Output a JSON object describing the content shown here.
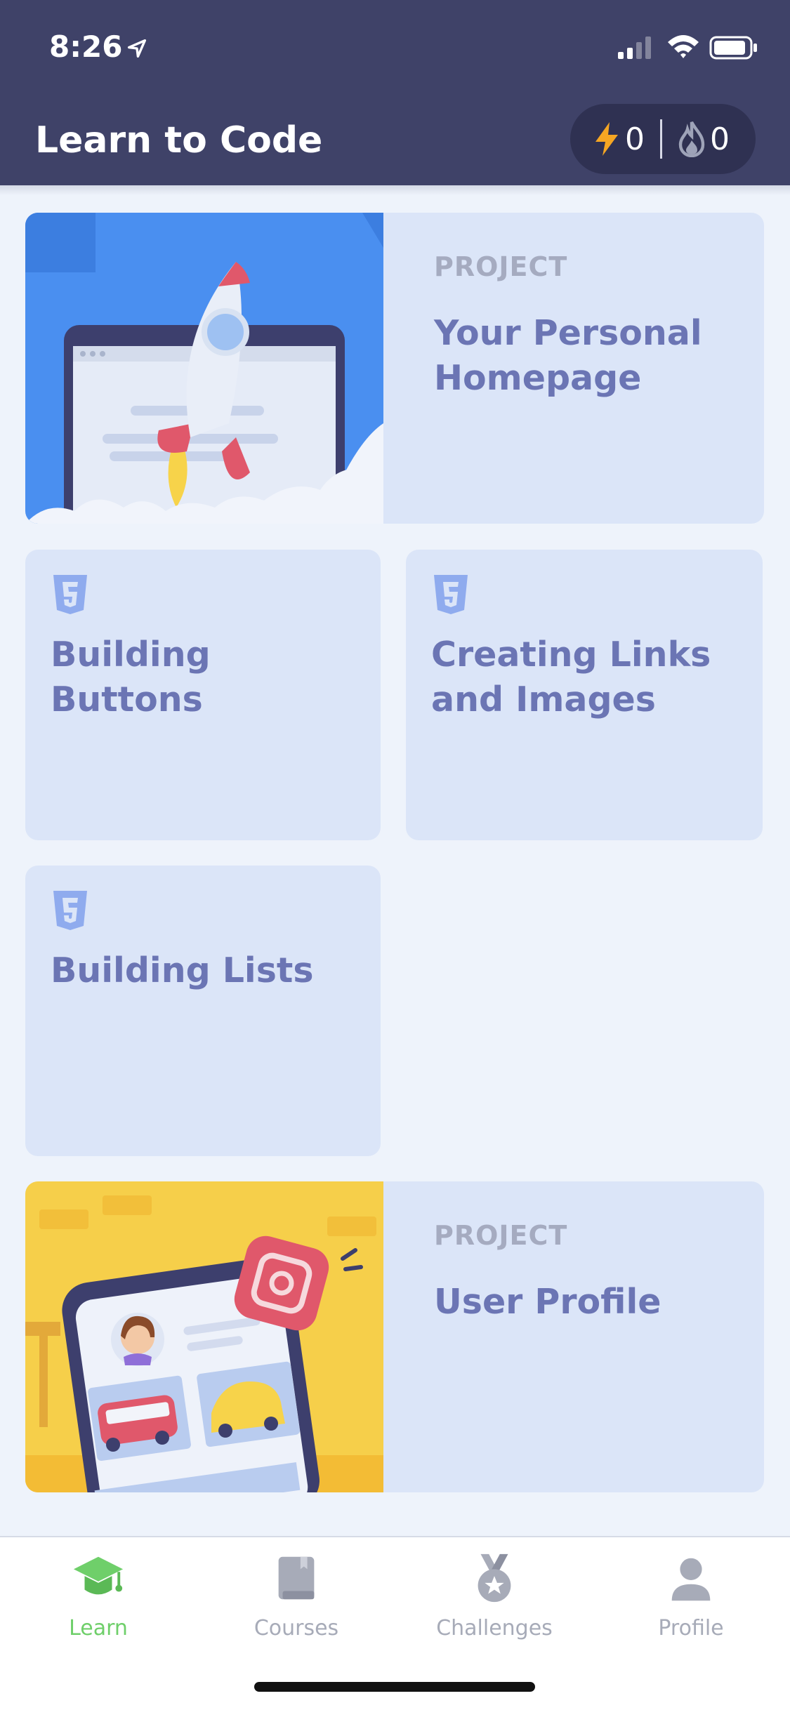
{
  "status_bar": {
    "time": "8:26"
  },
  "header": {
    "title": "Learn to Code",
    "bolts_count": "0",
    "streak_count": "0"
  },
  "cards": [
    {
      "kicker": "PROJECT",
      "title": "Your Personal Homepage"
    },
    {
      "title": "Building Buttons"
    },
    {
      "title": "Creating Links and Images"
    },
    {
      "title": "Building Lists"
    },
    {
      "kicker": "PROJECT",
      "title": "User Profile"
    }
  ],
  "tabbar": {
    "items": [
      {
        "label": "Learn",
        "icon": "graduation-cap-icon",
        "active": true
      },
      {
        "label": "Courses",
        "icon": "book-icon"
      },
      {
        "label": "Challenges",
        "icon": "medal-icon"
      },
      {
        "label": "Profile",
        "icon": "user-icon"
      }
    ]
  },
  "colors": {
    "header_bg": "#3f4268",
    "card_bg": "#dbe5f8",
    "card_title": "#6b75b4",
    "active_tab": "#6fcf6a"
  }
}
